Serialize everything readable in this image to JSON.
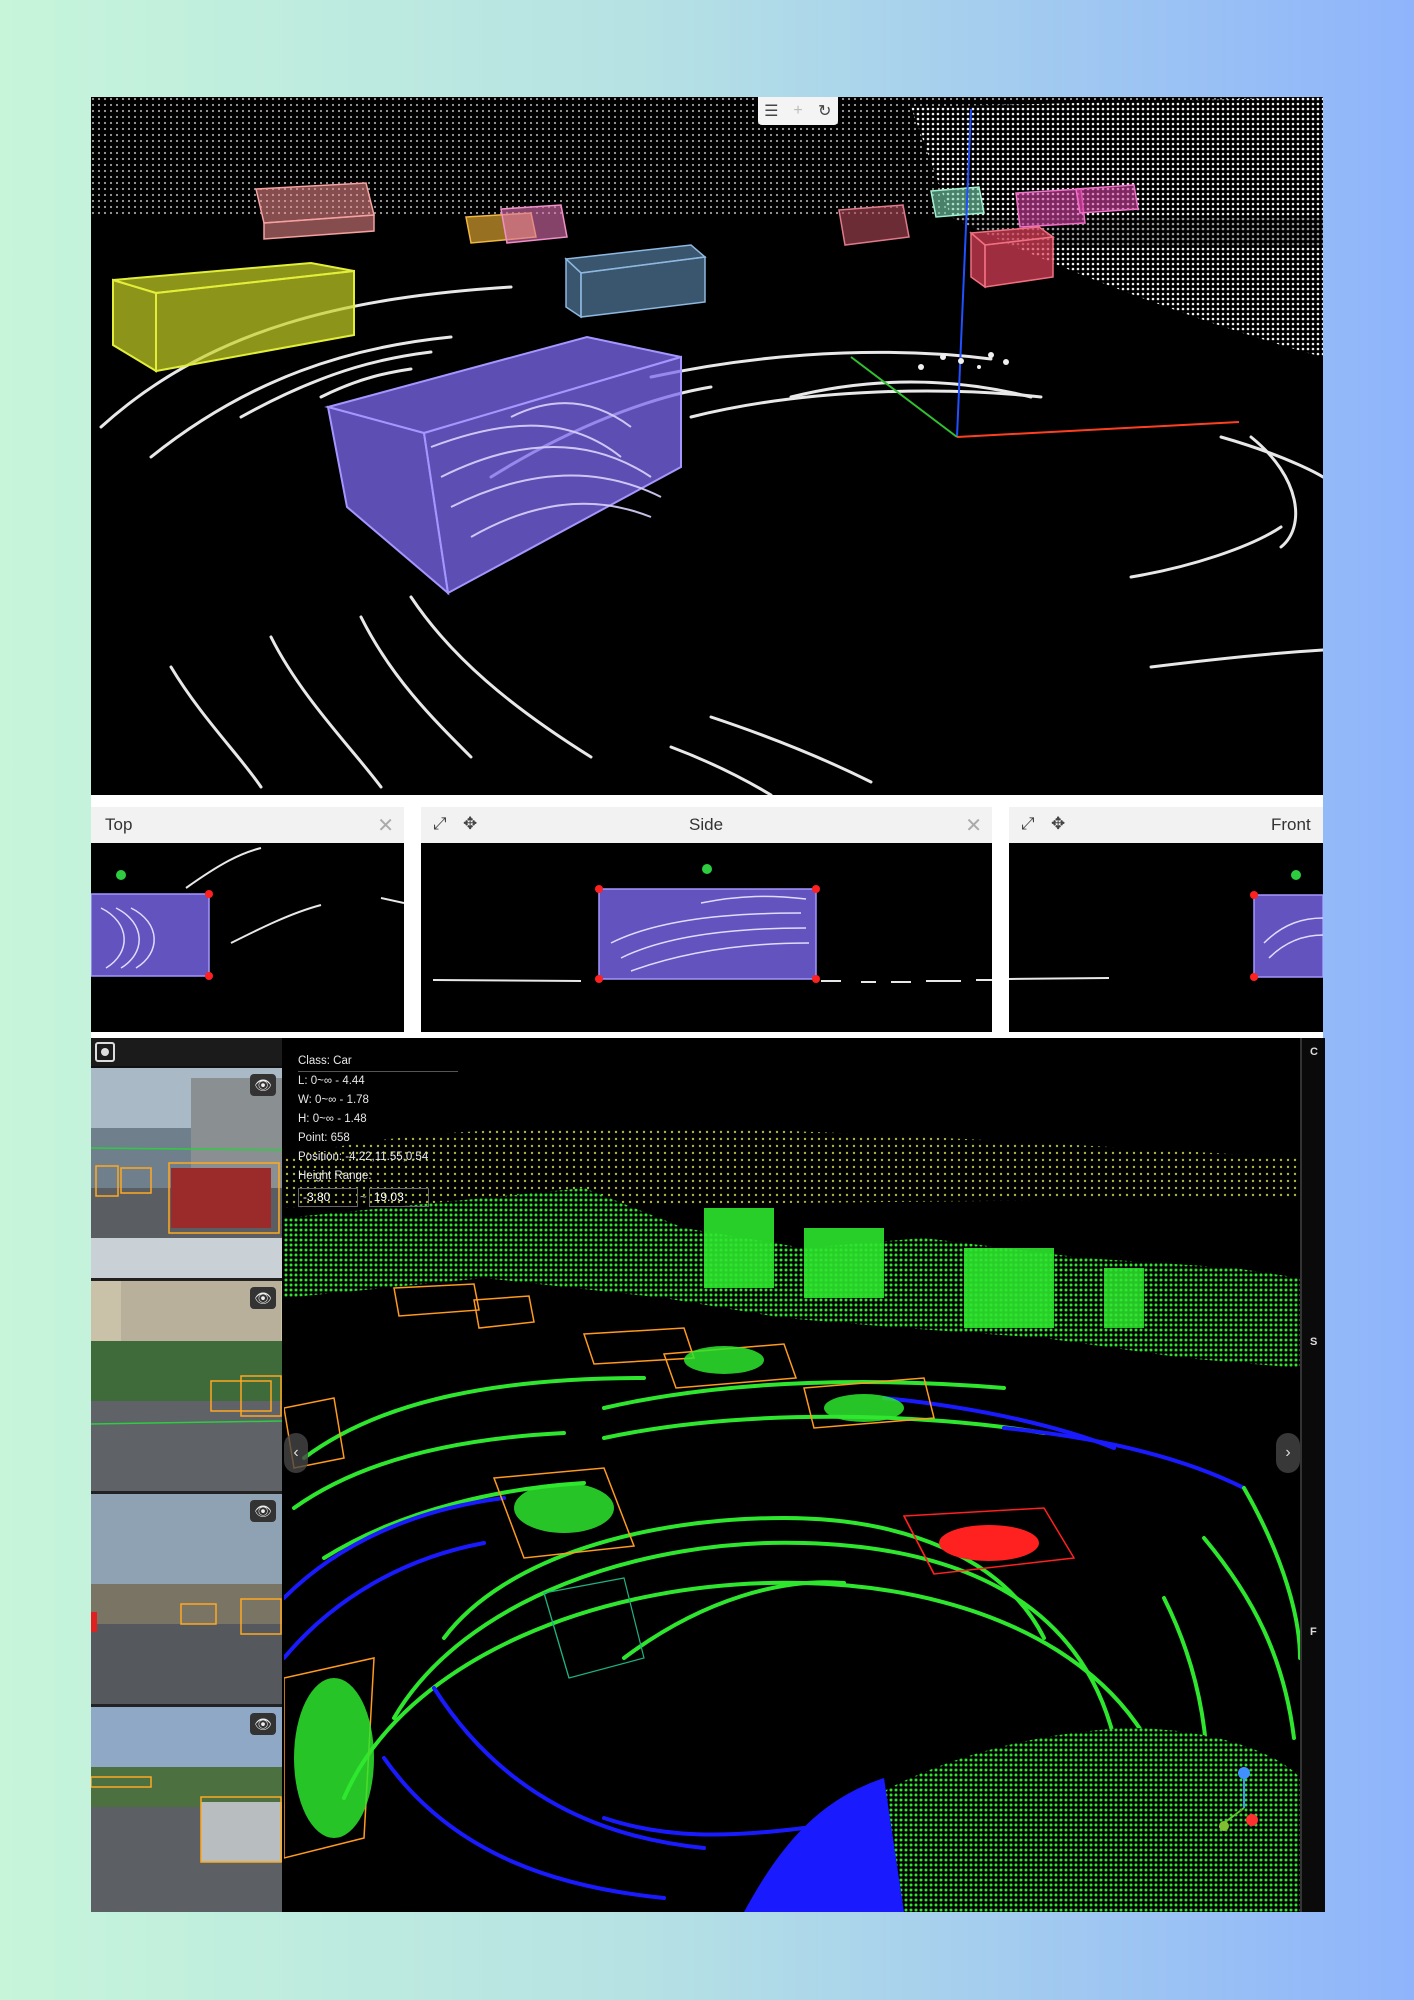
{
  "toolbar3d": {
    "icon1": "align-icon",
    "icon2": "plus-icon",
    "icon3": "refresh-icon"
  },
  "views": {
    "top": {
      "title": "Top"
    },
    "side": {
      "title": "Side"
    },
    "front": {
      "title": "Front"
    }
  },
  "info": {
    "class_line": "Class:  Car",
    "length_line": "L:  0~∞ - 4.44",
    "width_line": "W:  0~∞ - 1.78",
    "height_line": "H:  0~∞ - 1.48",
    "point_line": "Point:  658",
    "position_line": "Position:  -4.22,11.55,0.54",
    "height_range_label": "Height Range:",
    "range_min": "-3.80",
    "range_max": "19.03"
  },
  "right_strip": {
    "label_1": "C",
    "label_2": "S",
    "label_3": "F"
  },
  "colors": {
    "selected_box": "#7b68ee",
    "point_green": "#2ee62e",
    "ground_blue": "#1a1aff",
    "box_orange": "#ff9a1f",
    "box_red": "#ff2020"
  }
}
